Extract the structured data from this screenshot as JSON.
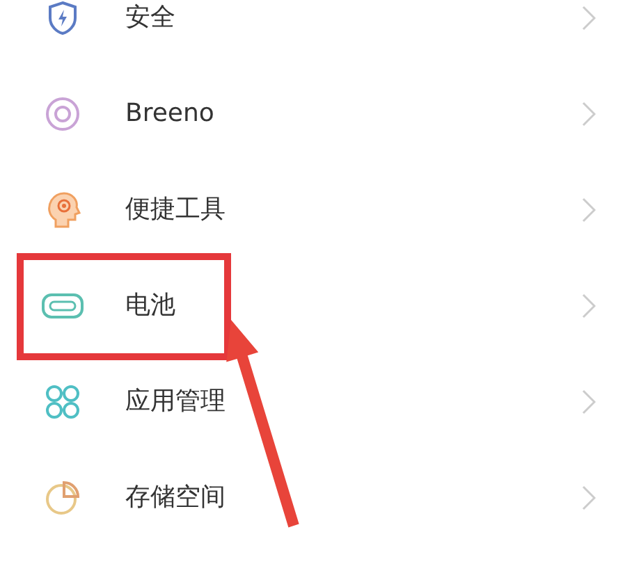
{
  "settings_items": [
    {
      "label": "安全",
      "highlighted": false
    },
    {
      "label": "Breeno",
      "highlighted": false
    },
    {
      "label": "便捷工具",
      "highlighted": false
    },
    {
      "label": "电池",
      "highlighted": true
    },
    {
      "label": "应用管理",
      "highlighted": false
    },
    {
      "label": "存储空间",
      "highlighted": false
    }
  ]
}
